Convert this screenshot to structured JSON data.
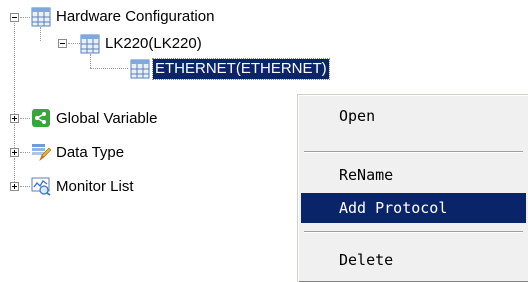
{
  "tree": {
    "hardware_configuration": {
      "label": "Hardware Configuration",
      "icon": "grid-config-icon",
      "state": "expanded"
    },
    "lk220": {
      "label": "LK220(LK220)",
      "icon": "grid-config-icon",
      "state": "expanded"
    },
    "ethernet": {
      "label": "ETHERNET(ETHERNET)",
      "icon": "grid-config-icon",
      "selected": true
    },
    "global_variable": {
      "label": "Global Variable",
      "icon": "share-icon",
      "state": "collapsed"
    },
    "data_type": {
      "label": "Data Type",
      "icon": "edit-pencil-icon",
      "state": "collapsed"
    },
    "monitor_list": {
      "label": "Monitor List",
      "icon": "monitor-icon",
      "state": "collapsed"
    }
  },
  "context_menu": {
    "items": [
      {
        "label": "Open"
      },
      {
        "label": "ReName"
      },
      {
        "label": "Add Protocol",
        "highlighted": true
      },
      {
        "label": "Delete"
      }
    ]
  },
  "colors": {
    "selection": "#0a246a",
    "menu_background": "#f0f0f0"
  }
}
